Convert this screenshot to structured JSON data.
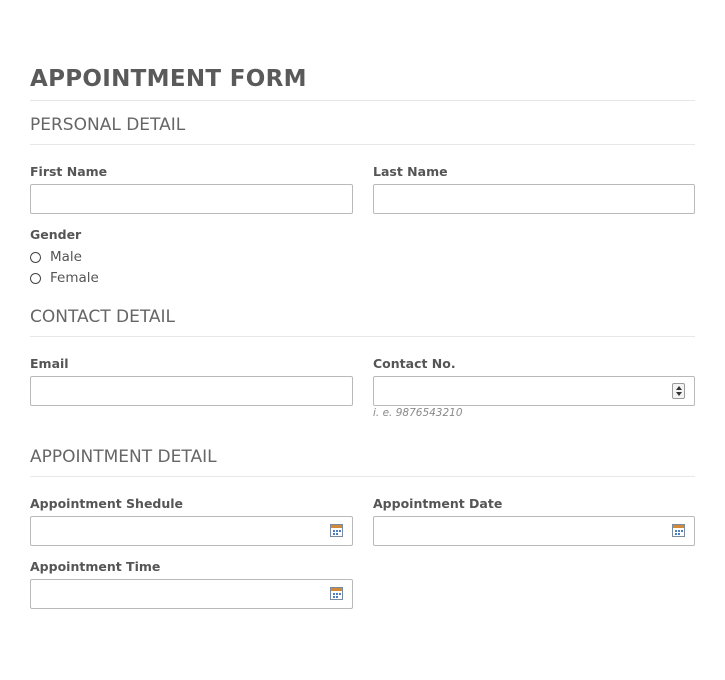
{
  "form": {
    "title": "APPOINTMENT FORM",
    "personal": {
      "heading": "PERSONAL DETAIL",
      "first_name_label": "First Name",
      "last_name_label": "Last Name",
      "gender_label": "Gender",
      "gender_options": [
        "Male",
        "Female"
      ]
    },
    "contact": {
      "heading": "CONTACT DETAIL",
      "email_label": "Email",
      "contact_label": "Contact No.",
      "contact_hint": "i. e. 9876543210"
    },
    "appointment": {
      "heading": "APPOINTMENT DETAIL",
      "schedule_label": "Appointment Shedule",
      "date_label": "Appointment Date",
      "time_label": "Appointment Time"
    }
  }
}
